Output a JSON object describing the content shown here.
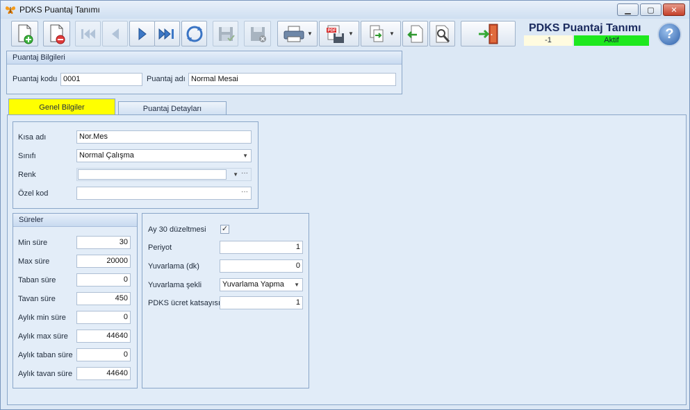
{
  "window": {
    "title": "PDKS Puantaj Tanımı",
    "buttons": {
      "minimize": "▁",
      "maximize": "▢",
      "close": "✕"
    }
  },
  "toolbar": {
    "icons": [
      "new-document-icon",
      "delete-document-icon",
      "first-record-icon",
      "previous-record-icon",
      "next-record-icon",
      "last-record-icon",
      "refresh-icon",
      "save-icon",
      "cancel-save-icon",
      "print-icon",
      "export-pdf-icon",
      "copy-pages-icon",
      "back-import-icon",
      "tools-icon",
      "exit-door-icon",
      "help-icon"
    ]
  },
  "header": {
    "title": "PDKS Puantaj Tanımı",
    "record_id": "-1",
    "status": "Aktif",
    "help": "?"
  },
  "puantaj_bilgileri": {
    "heading": "Puantaj Bilgileri",
    "kod_label": "Puantaj kodu",
    "kod_value": "0001",
    "ad_label": "Puantaj adı",
    "ad_value": "Normal Mesai"
  },
  "tabs": {
    "genel": "Genel Bilgiler",
    "detay": "Puantaj Detayları"
  },
  "genel": {
    "kisa_label": "Kısa adı",
    "kisa_value": "Nor.Mes",
    "sinif_label": "Sınıfı",
    "sinif_value": "Normal Çalışma",
    "renk_label": "Renk",
    "renk_value": "",
    "ozel_label": "Özel kod",
    "ozel_value": ""
  },
  "sureler": {
    "heading": "Süreler",
    "rows": [
      {
        "label": "Min süre",
        "value": "30"
      },
      {
        "label": "Max süre",
        "value": "20000"
      },
      {
        "label": "Taban süre",
        "value": "0"
      },
      {
        "label": "Tavan süre",
        "value": "450"
      },
      {
        "label": "Aylık min süre",
        "value": "0"
      },
      {
        "label": "Aylık max süre",
        "value": "44640"
      },
      {
        "label": "Aylık taban süre",
        "value": "0"
      },
      {
        "label": "Aylık tavan süre",
        "value": "44640"
      }
    ]
  },
  "ayarlar": {
    "ay30_label": "Ay 30 düzeltmesi",
    "ay30_checked": "✓",
    "periyot_label": "Periyot",
    "periyot_value": "1",
    "yuvarlama_label": "Yuvarlama (dk)",
    "yuvarlama_value": "0",
    "sekli_label": "Yuvarlama şekli",
    "sekli_value": "Yuvarlama Yapma",
    "katsayi_label": "PDKS ücret katsayısı",
    "katsayi_value": "1"
  },
  "colors": {
    "active_tab": "#ffff00",
    "status_active": "#1ee81e",
    "window_bg": "#dce8f5"
  }
}
